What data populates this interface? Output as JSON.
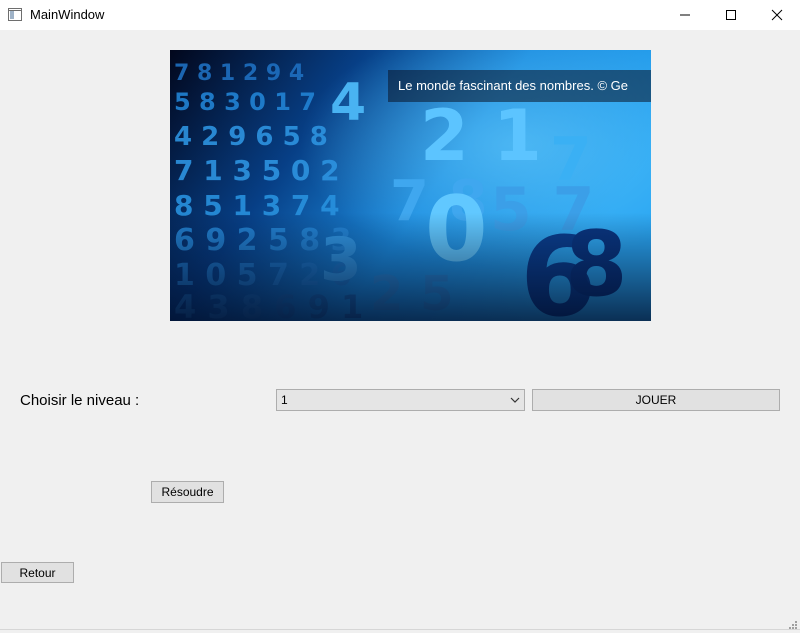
{
  "window": {
    "title": "MainWindow",
    "icon": "app-window-icon",
    "controls": [
      "minimize-icon",
      "maximize-icon",
      "close-icon"
    ]
  },
  "banner": {
    "caption": "Le monde fascinant des nombres. © Ge"
  },
  "form": {
    "level_label": "Choisir le niveau :",
    "level_value": "1",
    "play_button": "JOUER",
    "solve_button": "Résoudre",
    "back_button": "Retour"
  }
}
